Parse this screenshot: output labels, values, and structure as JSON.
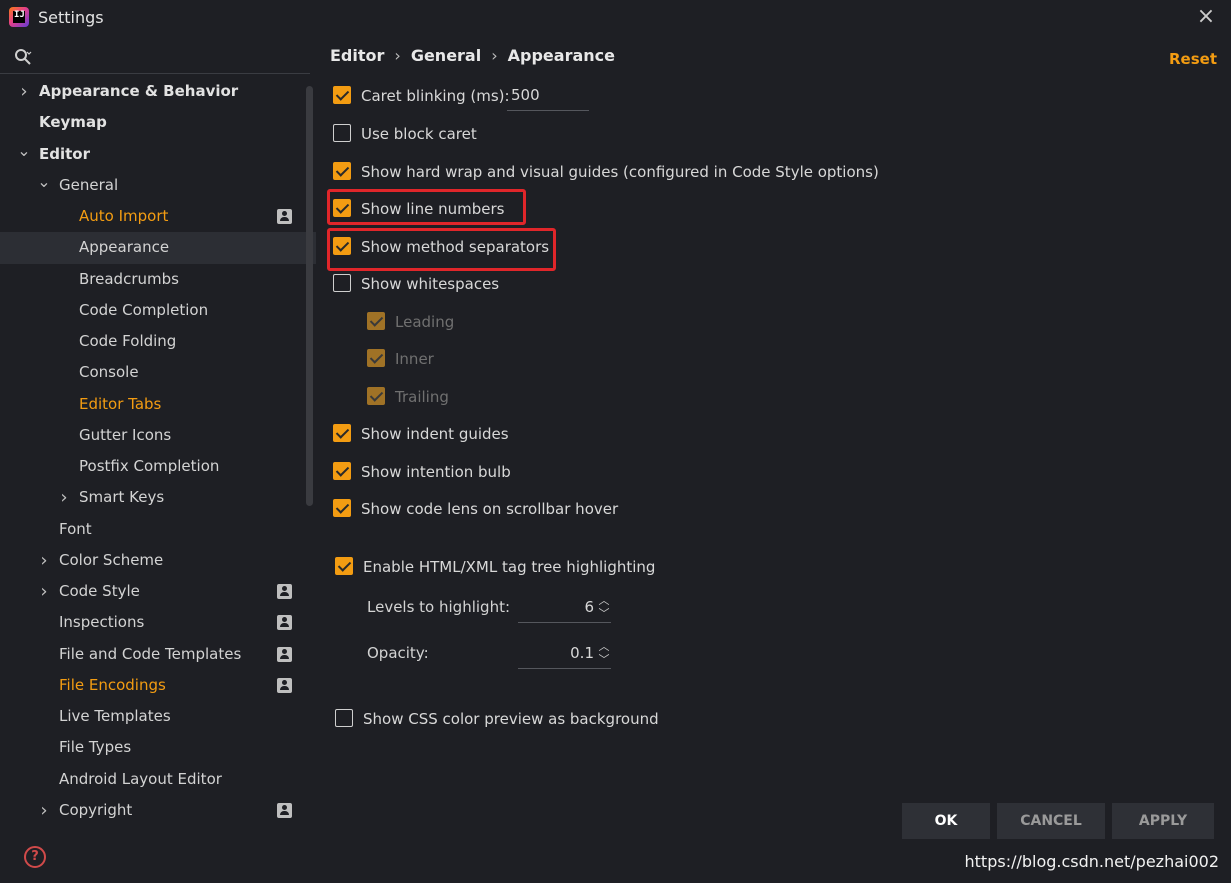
{
  "window": {
    "title": "Settings",
    "app_icon": "intellij-idea-icon",
    "close": "×"
  },
  "breadcrumb": [
    "Editor",
    "General",
    "Appearance"
  ],
  "reset_label": "Reset",
  "sidebar": {
    "items": [
      {
        "label": "Appearance & Behavior",
        "level": 0,
        "chevron": "right",
        "bold": true
      },
      {
        "label": "Keymap",
        "level": 0,
        "bold": true
      },
      {
        "label": "Editor",
        "level": 0,
        "chevron": "down",
        "bold": true
      },
      {
        "label": "General",
        "level": 1,
        "chevron": "down"
      },
      {
        "label": "Auto Import",
        "level": 2,
        "orange": true,
        "profile": true
      },
      {
        "label": "Appearance",
        "level": 2,
        "selected": true
      },
      {
        "label": "Breadcrumbs",
        "level": 2
      },
      {
        "label": "Code Completion",
        "level": 2
      },
      {
        "label": "Code Folding",
        "level": 2
      },
      {
        "label": "Console",
        "level": 2
      },
      {
        "label": "Editor Tabs",
        "level": 2,
        "orange": true
      },
      {
        "label": "Gutter Icons",
        "level": 2
      },
      {
        "label": "Postfix Completion",
        "level": 2
      },
      {
        "label": "Smart Keys",
        "level": 2,
        "chevron": "right"
      },
      {
        "label": "Font",
        "level": 1
      },
      {
        "label": "Color Scheme",
        "level": 1,
        "chevron": "right"
      },
      {
        "label": "Code Style",
        "level": 1,
        "chevron": "right",
        "profile": true
      },
      {
        "label": "Inspections",
        "level": 1,
        "profile": true
      },
      {
        "label": "File and Code Templates",
        "level": 1,
        "profile": true
      },
      {
        "label": "File Encodings",
        "level": 1,
        "orange": true,
        "profile": true
      },
      {
        "label": "Live Templates",
        "level": 1
      },
      {
        "label": "File Types",
        "level": 1
      },
      {
        "label": "Android Layout Editor",
        "level": 1
      },
      {
        "label": "Copyright",
        "level": 1,
        "chevron": "right",
        "profile": true
      }
    ]
  },
  "options": {
    "caret_blinking": {
      "label": "Caret blinking (ms):",
      "checked": true,
      "value": "500"
    },
    "use_block_caret": {
      "label": "Use block caret",
      "checked": false
    },
    "hard_wrap": {
      "label": "Show hard wrap and visual guides (configured in Code Style options)",
      "checked": true
    },
    "line_numbers": {
      "label": "Show line numbers",
      "checked": true
    },
    "method_separators": {
      "label": "Show method separators",
      "checked": true
    },
    "whitespaces": {
      "label": "Show whitespaces",
      "checked": false
    },
    "leading": {
      "label": "Leading",
      "checked": true
    },
    "inner": {
      "label": "Inner",
      "checked": true
    },
    "trailing": {
      "label": "Trailing",
      "checked": true
    },
    "indent_guides": {
      "label": "Show indent guides",
      "checked": true
    },
    "intention_bulb": {
      "label": "Show intention bulb",
      "checked": true
    },
    "code_lens": {
      "label": "Show code lens on scrollbar hover",
      "checked": true
    },
    "tag_tree": {
      "label": "Enable HTML/XML tag tree highlighting",
      "checked": true
    },
    "levels": {
      "label": "Levels to highlight:",
      "value": "6"
    },
    "opacity": {
      "label": "Opacity:",
      "value": "0.1"
    },
    "css_preview": {
      "label": "Show CSS color preview as background",
      "checked": false
    }
  },
  "buttons": {
    "ok": "OK",
    "cancel": "CANCEL",
    "apply": "APPLY"
  },
  "watermark": "https://blog.csdn.net/pezhai002",
  "colors": {
    "accent": "#f39c12",
    "background": "#1e1f24",
    "highlight": "#e0262a"
  }
}
